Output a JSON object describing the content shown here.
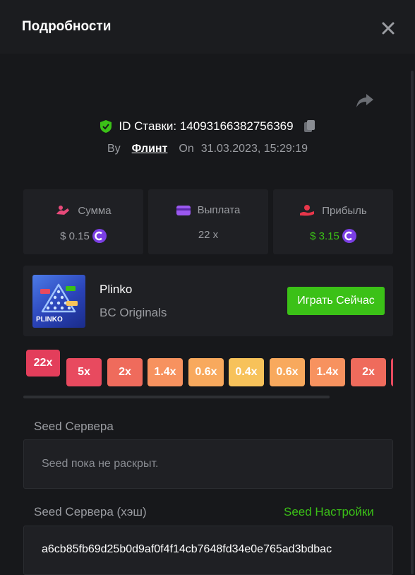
{
  "header": {
    "title": "Подробности",
    "close_icon": "close-icon"
  },
  "bet": {
    "id_label": "ID Ставки: 14093166382756369",
    "by_label": "By",
    "user": "Флинт",
    "on_label": "On",
    "date": "31.03.2023, 15:29:19"
  },
  "stats": {
    "amount": {
      "label": "Сумма",
      "value": "$ 0.15"
    },
    "payout": {
      "label": "Выплата",
      "value": "22 x"
    },
    "profit": {
      "label": "Прибыль",
      "value": "$ 3.15"
    }
  },
  "game": {
    "name": "Plinko",
    "provider": "BC Originals",
    "play_label": "Играть Сейчас",
    "thumb_label": "PLINKO"
  },
  "multipliers": {
    "items": [
      {
        "label": "22x",
        "color": "#e33e5b",
        "active": true
      },
      {
        "label": "5x",
        "color": "#e84a5f"
      },
      {
        "label": "2x",
        "color": "#ef6b5c"
      },
      {
        "label": "1.4x",
        "color": "#f7925f"
      },
      {
        "label": "0.6x",
        "color": "#f8a95d"
      },
      {
        "label": "0.4x",
        "color": "#f7c25a"
      },
      {
        "label": "0.6x",
        "color": "#f8a95d"
      },
      {
        "label": "1.4x",
        "color": "#f7925f"
      },
      {
        "label": "2x",
        "color": "#ef6b5c"
      },
      {
        "label": "",
        "color": "#e84a5f"
      }
    ]
  },
  "seeds": {
    "server_label": "Seed Сервера",
    "server_value": "Seed пока не раскрыт.",
    "hash_label": "Seed Сервера (хэш)",
    "settings_link": "Seed Настройки",
    "hash_value": "a6cb85fb69d25b0d9af0f4f14cb7648fd34e0e765ad3bdbac"
  },
  "colors": {
    "accent_green": "#3bc117",
    "background": "#17181b",
    "card": "#1f2024",
    "coin_purple": "#7b3fe4"
  }
}
